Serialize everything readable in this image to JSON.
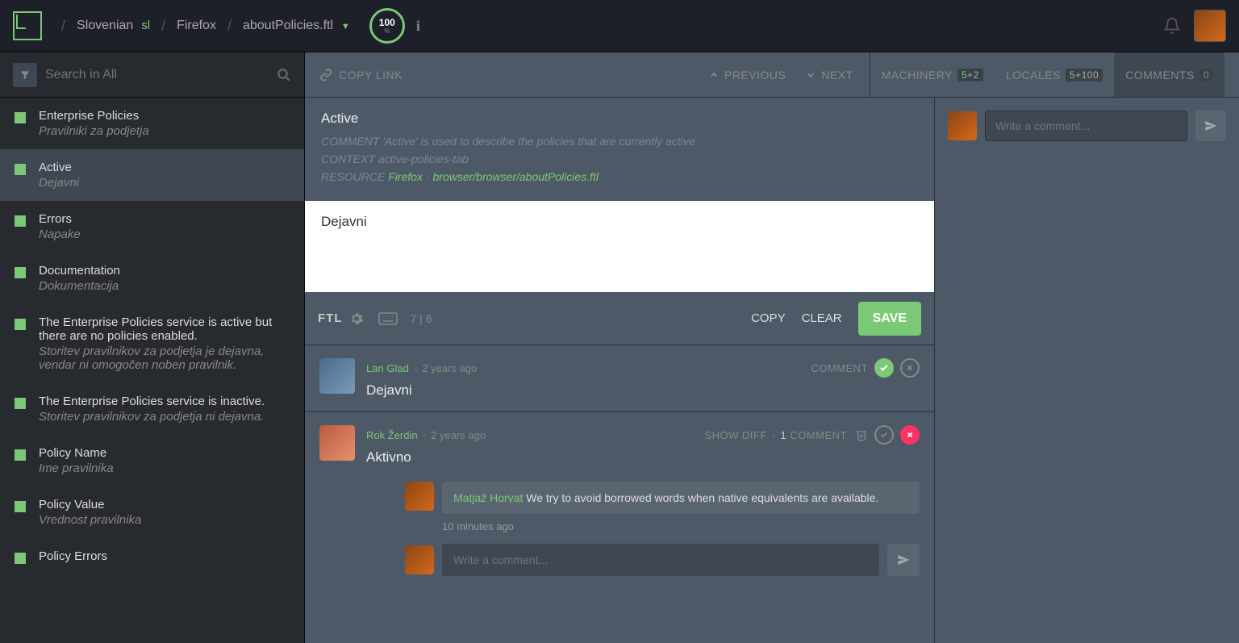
{
  "header": {
    "breadcrumb": {
      "locale": "Slovenian",
      "locale_code": "sl",
      "project": "Firefox",
      "resource": "aboutPolicies.ftl"
    },
    "progress": {
      "value": "100",
      "unit": "%"
    }
  },
  "search": {
    "placeholder": "Search in All"
  },
  "strings": [
    {
      "source": "Enterprise Policies",
      "translation": "Pravilniki za podjetja",
      "active": false
    },
    {
      "source": "Active",
      "translation": "Dejavni",
      "active": true
    },
    {
      "source": "Errors",
      "translation": "Napake",
      "active": false
    },
    {
      "source": "Documentation",
      "translation": "Dokumentacija",
      "active": false
    },
    {
      "source": "The Enterprise Policies service is active but there are no policies enabled.",
      "translation": "Storitev pravilnikov za podjetja je dejavna, vendar ni omogočen noben pravilnik.",
      "active": false
    },
    {
      "source": "The Enterprise Policies service is inactive.",
      "translation": "Storitev pravilnikov za podjetja ni dejavna.",
      "active": false
    },
    {
      "source": "Policy Name",
      "translation": "Ime pravilnika",
      "active": false
    },
    {
      "source": "Policy Value",
      "translation": "Vrednost pravilnika",
      "active": false
    },
    {
      "source": "Policy Errors",
      "translation": "",
      "active": false
    }
  ],
  "toolbar": {
    "copy_link": "COPY LINK",
    "previous": "PREVIOUS",
    "next": "NEXT",
    "machinery": {
      "label": "MACHINERY",
      "preferred": "5",
      "extra": "+2"
    },
    "locales": {
      "label": "LOCALES",
      "preferred": "5",
      "extra": "+100"
    },
    "comments": {
      "label": "COMMENTS",
      "count": "0"
    }
  },
  "detail": {
    "title": "Active",
    "comment_label": "COMMENT",
    "comment_text": "'Active' is used to describe the policies that are currently active",
    "context_label": "CONTEXT",
    "context_text": "active-policies-tab",
    "resource_label": "RESOURCE",
    "resource_project": "Firefox",
    "resource_path": "browser/browser/aboutPolicies.ftl",
    "editor_value": "Dejavni"
  },
  "editor_bar": {
    "ftl": "FTL",
    "chars": "7 | 6",
    "copy": "COPY",
    "clear": "CLEAR",
    "save": "SAVE"
  },
  "suggestions": [
    {
      "author": "Lan Glad",
      "time": "2 years ago",
      "text": "Dejavni",
      "approved": true,
      "meta_label": "COMMENT",
      "avatar_class": "avatar-lan"
    },
    {
      "author": "Rok Žerdin",
      "time": "2 years ago",
      "text": "Aktivno",
      "approved": false,
      "diff_label": "SHOW DIFF",
      "comment_count": "1",
      "comment_word": "COMMENT",
      "avatar_class": "avatar-rok"
    }
  ],
  "nested_comment": {
    "author": "Matjaž Horvat",
    "text": "We try to avoid borrowed words when native equivalents are available.",
    "time": "10 minutes ago"
  },
  "comment_placeholder": "Write a comment..."
}
